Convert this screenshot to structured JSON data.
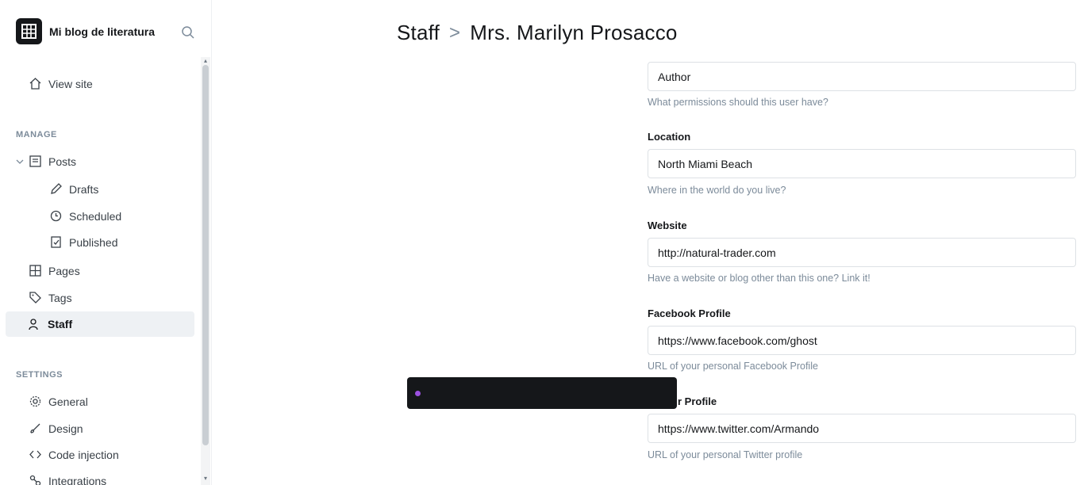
{
  "app": {
    "brand_name": "Mi blog de literatura"
  },
  "sidebar": {
    "view_site": "View site",
    "manage_label": "MANAGE",
    "posts": "Posts",
    "drafts": "Drafts",
    "scheduled": "Scheduled",
    "published": "Published",
    "pages": "Pages",
    "tags": "Tags",
    "staff": "Staff",
    "settings_label": "SETTINGS",
    "general": "General",
    "design": "Design",
    "code_injection": "Code injection",
    "integrations": "Integrations"
  },
  "header": {
    "crumb_root": "Staff",
    "crumb_sep": ">",
    "crumb_current": "Mrs. Marilyn Prosacco"
  },
  "form": {
    "role": {
      "value": "Author",
      "hint": "What permissions should this user have?"
    },
    "location": {
      "label": "Location",
      "value": "North Miami Beach",
      "hint": "Where in the world do you live?"
    },
    "website": {
      "label": "Website",
      "value": "http://natural-trader.com",
      "hint": "Have a website or blog other than this one? Link it!"
    },
    "facebook": {
      "label": "Facebook Profile",
      "value": "https://www.facebook.com/ghost",
      "hint": "URL of your personal Facebook Profile"
    },
    "twitter": {
      "label": "Twitter Profile",
      "label_visible": "r Profile",
      "value": "https://www.twitter.com/Armando",
      "hint": "URL of your personal Twitter profile"
    }
  },
  "colors": {
    "accent": "#9b51e0",
    "text": "#15171a",
    "muted": "#7c8b9a",
    "border": "#dde1e5",
    "active_bg": "#eef1f4"
  }
}
